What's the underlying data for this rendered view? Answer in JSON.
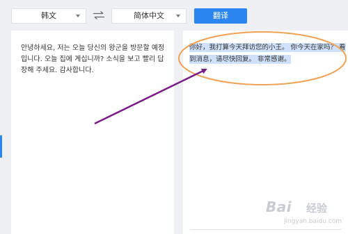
{
  "toolbar": {
    "source_language": "韩文",
    "target_language": "简体中文",
    "translate_label": "翻译"
  },
  "source": {
    "text": "안녕하세요, 저는 오늘 당신의 왕군을 방문할 예정입니다. 오늘 집에 계십니까? 소식을 보고 빨리 답장해 주세요. 감사합니다."
  },
  "translation": {
    "text": "你好，我打算今天拜访您的小王。 你今天在家吗？ 看到消息，请尽快回复。 非常感谢。"
  },
  "annotation": {
    "ellipse_color": "#f0a154",
    "arrow_color": "#7a1a86"
  },
  "watermark": {
    "brand": "Bai",
    "cn": "经验",
    "url": "jingyan.baidu.com"
  }
}
